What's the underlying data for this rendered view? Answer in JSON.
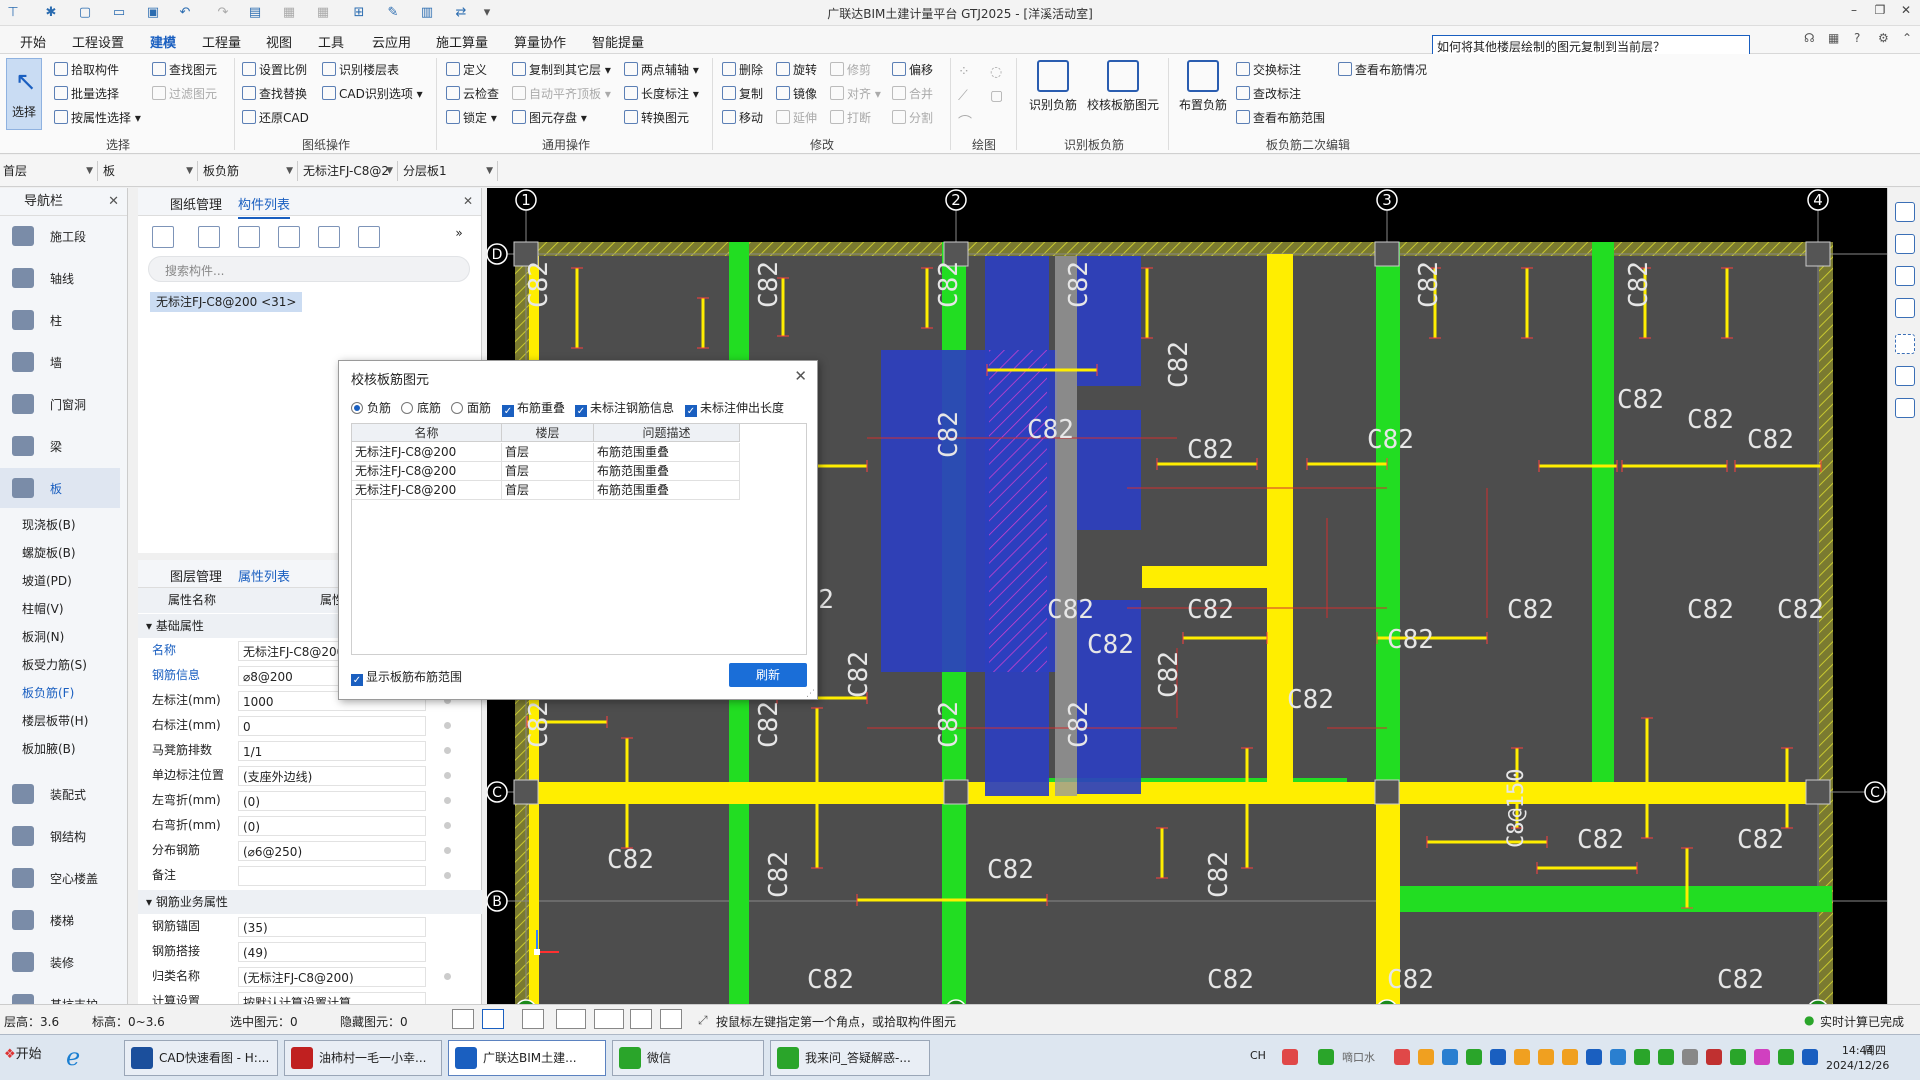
{
  "app": {
    "title": "广联达BIM土建计量平台 GTJ2025 - [洋溪活动室]"
  },
  "menu": [
    "开始",
    "工程设置",
    "建模",
    "工程量",
    "视图",
    "工具",
    "云应用",
    "施工算量",
    "算量协作",
    "智能提量"
  ],
  "menu_active_index": 2,
  "help_search": {
    "value": "如何将其他楼层绘制的图元复制到当前层？"
  },
  "ribbon": {
    "select_big": "选择",
    "select_group": {
      "items": [
        "拾取构件",
        "批量选择",
        "按属性选择"
      ],
      "items_disabled": [
        "查找图元",
        "过滤图元"
      ],
      "label": "选择"
    },
    "drawing_ops": {
      "items": [
        "设置比例",
        "查找替换",
        "还原CAD",
        "识别楼层表",
        "CAD识别选项"
      ],
      "label": "图纸操作"
    },
    "general_ops": {
      "items": [
        "定义",
        "云检查",
        "锁定",
        "复制到其它层",
        "自动平齐顶板",
        "图元存盘",
        "两点辅轴",
        "长度标注",
        "转换图元"
      ],
      "label": "通用操作"
    },
    "modify": {
      "items": [
        "删除",
        "复制",
        "移动",
        "旋转",
        "镜像",
        "偏移"
      ],
      "items_disabled": [
        "延伸",
        "修剪",
        "对齐",
        "打断",
        "合并",
        "分割"
      ],
      "label": "修改"
    },
    "draw": {
      "label": "绘图"
    },
    "identify": {
      "buttons": [
        "识别负筋",
        "校核板筋图元"
      ],
      "label": "识别板负筋"
    },
    "secondary_edit": {
      "big": "布置负筋",
      "items": [
        "交换标注",
        "查改标注",
        "查看布筋范围",
        "查看布筋情况"
      ],
      "label": "板负筋二次编辑"
    }
  },
  "filters": [
    "首层",
    "板",
    "板负筋",
    "无标注FJ-C8@2",
    "分层板1"
  ],
  "nav": {
    "title": "导航栏",
    "categories": [
      {
        "label": "施工段",
        "icon": "construction-segment-icon"
      },
      {
        "label": "轴线",
        "icon": "axis-grid-icon"
      },
      {
        "label": "柱",
        "icon": "column-icon"
      },
      {
        "label": "墙",
        "icon": "wall-icon"
      },
      {
        "label": "门窗洞",
        "icon": "door-window-icon"
      },
      {
        "label": "梁",
        "icon": "beam-icon"
      },
      {
        "label": "板",
        "icon": "slab-icon"
      }
    ],
    "sub_items": [
      "现浇板(B)",
      "螺旋板(B)",
      "坡道(PD)",
      "柱帽(V)",
      "板洞(N)",
      "板受力筋(S)",
      "板负筋(F)",
      "楼层板带(H)",
      "板加腋(B)"
    ],
    "sub_active_index": 6,
    "more_categories": [
      {
        "label": "装配式",
        "icon": "prefab-icon"
      },
      {
        "label": "钢结构",
        "icon": "steel-structure-icon"
      },
      {
        "label": "空心楼盖",
        "icon": "hollow-floor-icon"
      },
      {
        "label": "楼梯",
        "icon": "stair-icon"
      },
      {
        "label": "装修",
        "icon": "decoration-icon"
      },
      {
        "label": "基坑支护",
        "icon": "pit-support-icon"
      }
    ]
  },
  "component_panel": {
    "tabs": [
      "图纸管理",
      "构件列表"
    ],
    "search_placeholder": "搜索构件...",
    "items": [
      "无标注FJ-C8@200 <31>"
    ]
  },
  "property_panel": {
    "tabs": [
      "图层管理",
      "属性列表"
    ],
    "header": {
      "name": "属性名称",
      "value": "属性"
    },
    "section1": "基础属性",
    "rows": [
      {
        "name": "名称",
        "value": "无标注FJ-C8@200",
        "blue": true
      },
      {
        "name": "钢筋信息",
        "value": "⌀8@200",
        "blue": true
      },
      {
        "name": "左标注(mm)",
        "value": "1000"
      },
      {
        "name": "右标注(mm)",
        "value": "0"
      },
      {
        "name": "马凳筋排数",
        "value": "1/1"
      },
      {
        "name": "单边标注位置",
        "value": "(支座外边线)"
      },
      {
        "name": "左弯折(mm)",
        "value": "(0)"
      },
      {
        "name": "右弯折(mm)",
        "value": "(0)"
      },
      {
        "name": "分布钢筋",
        "value": "(⌀6@250)"
      },
      {
        "name": "备注",
        "value": ""
      }
    ],
    "section2": "钢筋业务属性",
    "rows2": [
      {
        "name": "钢筋锚固",
        "value": "(35)"
      },
      {
        "name": "钢筋搭接",
        "value": "(49)"
      },
      {
        "name": "归类名称",
        "value": "(无标注FJ-C8@200)"
      },
      {
        "name": "计算设置",
        "value": "按默认计算设置计算"
      }
    ]
  },
  "dialog": {
    "title": "校核板筋图元",
    "radios": [
      "负筋",
      "底筋",
      "面筋"
    ],
    "radio_selected": 0,
    "checks": [
      "布筋重叠",
      "未标注钢筋信息",
      "未标注伸出长度"
    ],
    "columns": [
      "名称",
      "楼层",
      "问题描述"
    ],
    "rows": [
      [
        "无标注FJ-C8@200",
        "首层",
        "布筋范围重叠"
      ],
      [
        "无标注FJ-C8@200",
        "首层",
        "布筋范围重叠"
      ],
      [
        "无标注FJ-C8@200",
        "首层",
        "布筋范围重叠"
      ]
    ],
    "show_range": "显示板筋布筋范围",
    "refresh": "刷新"
  },
  "canvas": {
    "axis_labels_top": [
      "1",
      "2",
      "3",
      "4"
    ],
    "axis_labels_left": [
      "D",
      "C",
      "B"
    ],
    "axis_label_right": "C",
    "rebar_label": "C82",
    "rebar_label_alt": "C8@150",
    "colors": {
      "background": "#000000",
      "slab": "#4d4d4d",
      "beam_yellow": "#ffee00",
      "beam_green": "#22dd22",
      "selected_blue": "#2c3fbf",
      "hatch": "#7a7a30"
    }
  },
  "status": {
    "floor_height": "层高：3.6",
    "elevation": "标高：0~3.6",
    "selected": "选中图元：0",
    "hidden": "隐藏图元：0",
    "hint": "按鼠标左键指定第一个角点，或拾取构件图元",
    "realtime": "实时计算已完成"
  },
  "taskbar": {
    "start": "开始",
    "tasks": [
      "CAD快速看图 - H:...",
      "油柿村一毛一小幸...",
      "广联达BIM土建...",
      "微信",
      "我来问_答疑解惑-..."
    ],
    "active_index": 2,
    "tray_text": [
      "CH",
      "嘀口水"
    ],
    "time": "14:44",
    "weekday": "周四",
    "date": "2024/12/26"
  }
}
